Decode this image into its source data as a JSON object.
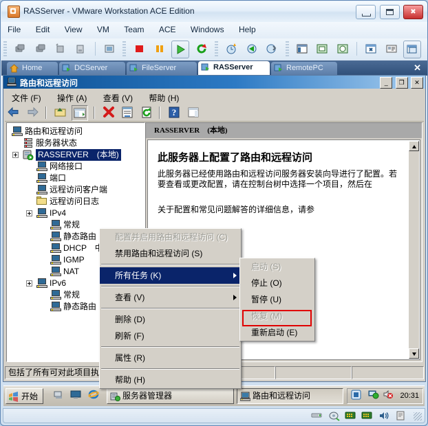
{
  "vmware": {
    "title": "RASServer - VMware Workstation ACE Edition",
    "window_buttons": {
      "minimize": "minimize-button",
      "maximize": "maximize-button",
      "close": "close-button"
    },
    "menu": [
      "File",
      "Edit",
      "View",
      "VM",
      "Team",
      "ACE",
      "Windows",
      "Help"
    ],
    "toolbar_icons": [
      "power-off-vm-icon",
      "suspend-vm-icon",
      "reset-vm-icon",
      "snapshot-manager-icon",
      "edit-vm-settings-icon",
      "stop-icon",
      "pause-icon",
      "play-icon",
      "reset-icon",
      "take-snapshot-icon",
      "revert-snapshot-icon",
      "manage-snapshots-icon",
      "show-sidebar-icon",
      "quick-switch-icon",
      "full-screen-icon",
      "preferences-icon",
      "summary-view-icon",
      "console-view-icon"
    ],
    "tabs": [
      {
        "label": "Home",
        "icon": "home-icon",
        "active": false
      },
      {
        "label": "DCServer",
        "icon": "vm-icon",
        "active": false
      },
      {
        "label": "FileServer",
        "icon": "vm-icon",
        "active": false
      },
      {
        "label": "RASServer",
        "icon": "vm-icon",
        "active": true
      },
      {
        "label": "RemotePC",
        "icon": "vm-icon",
        "active": false
      }
    ],
    "tabs_close_label": "✕",
    "status_tray_icons": [
      "hdd-icon",
      "cd-dvd-icon",
      "network1-icon",
      "network2-icon",
      "sound-icon",
      "printer-icon"
    ]
  },
  "mmc": {
    "title": "路由和远程访问",
    "window_buttons": {
      "minimize": "_",
      "restore": "❐",
      "close": "✕"
    },
    "menu": [
      "文件 (F)",
      "操作 (A)",
      "查看 (V)",
      "帮助 (H)"
    ],
    "toolbar_icons": [
      "back-icon",
      "forward-icon",
      "up-one-level-icon",
      "show-hide-tree-icon",
      "delete-icon",
      "properties-icon",
      "refresh-icon",
      "help-icon",
      "show-action-pane-icon"
    ],
    "tree": [
      {
        "label": "路由和远程访问",
        "indent": 0,
        "icon": "computer-icon",
        "expander": "none",
        "selected": false
      },
      {
        "label": "服务器状态",
        "indent": 1,
        "icon": "server-icon",
        "expander": "none",
        "selected": false
      },
      {
        "label": "RASSERVER　(本地)",
        "indent": 1,
        "icon": "server-active-icon",
        "expander": "expanded",
        "selected": true
      },
      {
        "label": "网络接口",
        "indent": 2,
        "icon": "computer-icon",
        "expander": "none",
        "selected": false
      },
      {
        "label": "端口",
        "indent": 2,
        "icon": "computer-icon",
        "expander": "none",
        "selected": false
      },
      {
        "label": "远程访问客户端",
        "indent": 2,
        "icon": "computer-icon",
        "expander": "none",
        "selected": false
      },
      {
        "label": "远程访问日志",
        "indent": 2,
        "icon": "folder-icon",
        "expander": "none",
        "selected": false
      },
      {
        "label": "IPv4",
        "indent": 2,
        "icon": "computer-icon",
        "expander": "expanded",
        "selected": false
      },
      {
        "label": "常规",
        "indent": 3,
        "icon": "computer-icon",
        "expander": "none",
        "selected": false
      },
      {
        "label": "静态路由",
        "indent": 3,
        "icon": "computer-icon",
        "expander": "none",
        "selected": false
      },
      {
        "label": "DHCP　中继代理程序",
        "indent": 3,
        "icon": "computer-icon",
        "expander": "none",
        "selected": false
      },
      {
        "label": "IGMP",
        "indent": 3,
        "icon": "computer-icon",
        "expander": "none",
        "selected": false
      },
      {
        "label": "NAT",
        "indent": 3,
        "icon": "computer-icon",
        "expander": "none",
        "selected": false
      },
      {
        "label": "IPv6",
        "indent": 2,
        "icon": "computer-icon",
        "expander": "expanded",
        "selected": false
      },
      {
        "label": "常规",
        "indent": 3,
        "icon": "computer-icon",
        "expander": "none",
        "selected": false
      },
      {
        "label": "静态路由",
        "indent": 3,
        "icon": "computer-icon",
        "expander": "none",
        "selected": false
      }
    ],
    "right_pane": {
      "header": "RASSERVER　(本地)",
      "heading": "此服务器上配置了路由和远程访问",
      "paragraph1": "此服务器已经使用路由和远程访问服务器安装向导进行了配置。若要查看或更改配置，请在控制台树中选择一个项目，然后在",
      "paragraph2": "关于配置和常见问题解答的详细信息，请参"
    },
    "status_bar": {
      "text": "包括了所有可对此项目执行的操作。",
      "cell2": "",
      "cell3": ""
    }
  },
  "context_menu": {
    "items": [
      {
        "label": "配置并启用路由和远程访问 (C)",
        "state": "disabled",
        "submenu": false
      },
      {
        "label": "禁用路由和远程访问 (S)",
        "state": "normal",
        "submenu": false
      },
      {
        "label": "---",
        "state": "separator",
        "submenu": false
      },
      {
        "label": "所有任务 (K)",
        "state": "highlighted",
        "submenu": true
      },
      {
        "label": "---",
        "state": "separator",
        "submenu": false
      },
      {
        "label": "查看 (V)",
        "state": "normal",
        "submenu": true
      },
      {
        "label": "---",
        "state": "separator",
        "submenu": false
      },
      {
        "label": "删除 (D)",
        "state": "normal",
        "submenu": false
      },
      {
        "label": "刷新 (F)",
        "state": "normal",
        "submenu": false
      },
      {
        "label": "---",
        "state": "separator",
        "submenu": false
      },
      {
        "label": "属性 (R)",
        "state": "normal",
        "submenu": false
      },
      {
        "label": "---",
        "state": "separator",
        "submenu": false
      },
      {
        "label": "帮助 (H)",
        "state": "normal",
        "submenu": false
      }
    ]
  },
  "submenu": {
    "items": [
      {
        "label": "启动 (S)",
        "state": "disabled",
        "highlight_box": false
      },
      {
        "label": "停止 (O)",
        "state": "normal",
        "highlight_box": false
      },
      {
        "label": "暂停 (U)",
        "state": "normal",
        "highlight_box": false
      },
      {
        "label": "恢复 (M)",
        "state": "disabled",
        "highlight_box": false
      },
      {
        "label": "重新启动 (E)",
        "state": "normal",
        "highlight_box": true
      }
    ],
    "highlight_color": "#e00000"
  },
  "taskbar": {
    "start_label": "开始",
    "quick_launch": [
      "show-desktop-icon",
      "desktop-icon",
      "internet-explorer-icon"
    ],
    "tasks": [
      {
        "label": "服务器管理器",
        "icon": "server-manager-icon",
        "active": false
      },
      {
        "label": "路由和远程访问",
        "icon": "mmc-icon",
        "active": true
      }
    ],
    "tray_icons": [
      "vm-tools-icon",
      "network-icon",
      "volume-muted-icon"
    ],
    "clock": "20:31"
  }
}
